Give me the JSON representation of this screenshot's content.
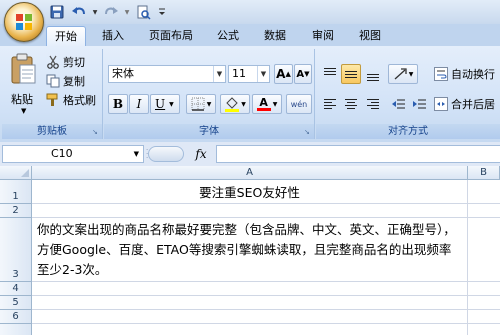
{
  "quick_access": {
    "icons": [
      "save-icon",
      "undo-icon",
      "redo-icon",
      "print-preview-icon",
      "customize-arrow-icon"
    ]
  },
  "tabs": [
    {
      "label": "开始",
      "active": true
    },
    {
      "label": "插入",
      "active": false
    },
    {
      "label": "页面布局",
      "active": false
    },
    {
      "label": "公式",
      "active": false
    },
    {
      "label": "数据",
      "active": false
    },
    {
      "label": "审阅",
      "active": false
    },
    {
      "label": "视图",
      "active": false
    }
  ],
  "ribbon": {
    "clipboard": {
      "paste_label": "粘贴",
      "cut_label": "剪切",
      "copy_label": "复制",
      "format_painter_label": "格式刷",
      "group_label": "剪贴板"
    },
    "font": {
      "font_name": "宋体",
      "font_size": "11",
      "grow_label": "A",
      "shrink_label": "A",
      "bold_label": "B",
      "italic_label": "I",
      "underline_label": "U",
      "font_color_label": "A",
      "phonetic_label": "wén",
      "group_label": "字体",
      "fill_color": "#ffff00",
      "font_color": "#ff0000"
    },
    "alignment": {
      "wrap_text_label": "自动换行",
      "merge_center_label": "合并后居",
      "group_label": "对齐方式",
      "vertical_align_selected": "middle"
    }
  },
  "formula_bar": {
    "name_box": "C10",
    "fx_label": "fx",
    "formula": ""
  },
  "sheet": {
    "columns": [
      "A",
      "B"
    ],
    "rows": [
      "1",
      "2",
      "3",
      "4",
      "5",
      "6"
    ],
    "cells": {
      "A1": "要注重SEO友好性",
      "A3": "你的文案出现的商品名称最好要完整（包含品牌、中文、英文、正确型号），方便Google、百度、ETAO等搜索引擎蜘蛛读取，且完整商品名的出现频率至少2-3次。"
    }
  }
}
